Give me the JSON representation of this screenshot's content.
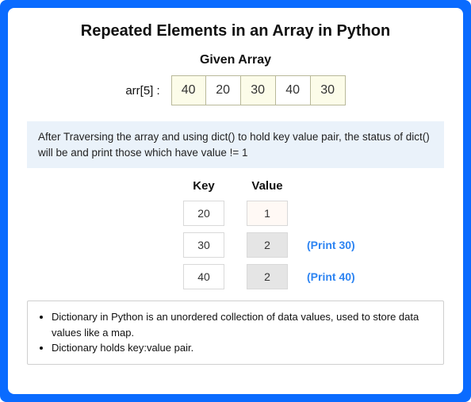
{
  "title": "Repeated Elements in an Array in Python",
  "given_array_label": "Given Array",
  "array_label": "arr[5] :",
  "array_cells": [
    {
      "value": "40",
      "highlight": true
    },
    {
      "value": "20",
      "highlight": false
    },
    {
      "value": "30",
      "highlight": true
    },
    {
      "value": "40",
      "highlight": false
    },
    {
      "value": "30",
      "highlight": true
    }
  ],
  "explanation": "After Traversing the array and using dict() to hold key value pair, the status of dict() will be and print those which have value != 1",
  "kv_header": {
    "key": "Key",
    "value": "Value"
  },
  "kv_rows": [
    {
      "key": "20",
      "value": "1",
      "value_style": "light",
      "print": ""
    },
    {
      "key": "30",
      "value": "2",
      "value_style": "gray",
      "print": "(Print 30)"
    },
    {
      "key": "40",
      "value": "2",
      "value_style": "gray",
      "print": "(Print 40)"
    }
  ],
  "footer": {
    "bullet1": "Dictionary in Python is an unordered collection of data values, used to store data values like a map.",
    "bullet2": "Dictionary holds key:value pair."
  }
}
